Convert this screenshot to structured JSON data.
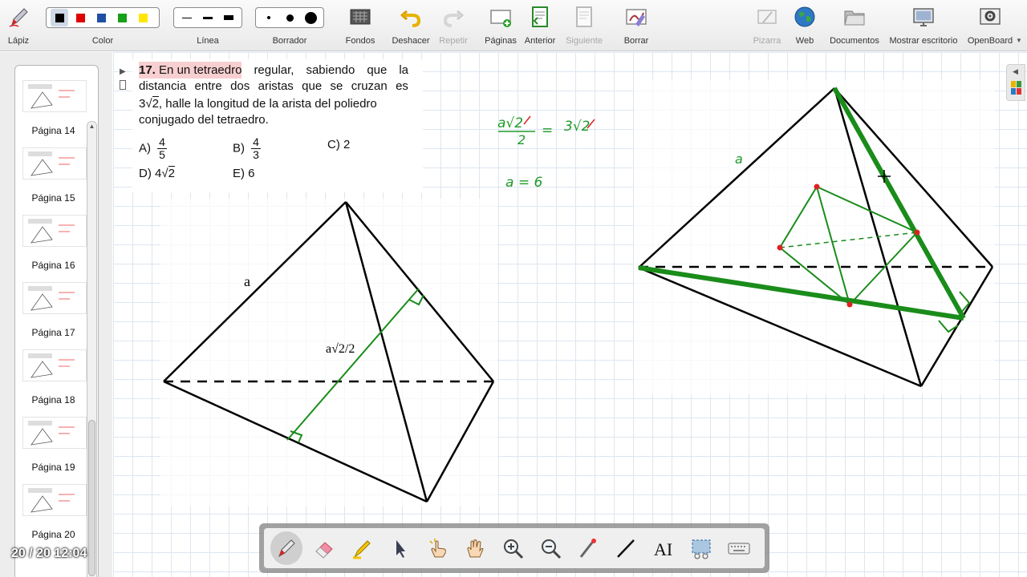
{
  "toolbar": {
    "pen": {
      "label": "Lápiz",
      "icon": "pen-icon"
    },
    "color": {
      "label": "Color",
      "swatches": [
        "#000000",
        "#e00000",
        "#1f4fa3",
        "#18a018",
        "#ffe600"
      ]
    },
    "line": {
      "label": "Línea"
    },
    "eraser": {
      "label": "Borrador"
    },
    "backgrounds": {
      "label": "Fondos",
      "icon": "backgrounds-icon"
    },
    "undo": {
      "label": "Deshacer",
      "icon": "undo-icon"
    },
    "redo": {
      "label": "Repetir",
      "icon": "redo-icon"
    },
    "pages": {
      "label": "Páginas",
      "icon": "add-page-icon"
    },
    "previous": {
      "label": "Anterior",
      "icon": "previous-page-icon"
    },
    "next": {
      "label": "Siguiente",
      "icon": "next-page-icon"
    },
    "clear": {
      "label": "Borrar",
      "icon": "clear-page-icon"
    },
    "board": {
      "label": "Pizarra",
      "icon": "board-icon"
    },
    "web": {
      "label": "Web",
      "icon": "globe-icon"
    },
    "documents": {
      "label": "Documentos",
      "icon": "folder-icon"
    },
    "desktop": {
      "label": "Mostrar escritorio",
      "icon": "monitor-icon"
    },
    "openboard": {
      "label": "OpenBoard",
      "icon": "openboard-gear-icon"
    }
  },
  "sidebar": {
    "thumbnails": [
      {
        "label": "Página 14"
      },
      {
        "label": "Página 15"
      },
      {
        "label": "Página 16"
      },
      {
        "label": "Página 17"
      },
      {
        "label": "Página 18"
      },
      {
        "label": "Página 19"
      },
      {
        "label": "Página 20"
      }
    ],
    "page_counter": "20 / 20 12:04"
  },
  "problem": {
    "number": "17.",
    "line1_words": [
      "En",
      "un",
      "tetraedro",
      "regular,",
      "sabiendo",
      "que",
      "la"
    ],
    "line2_words": [
      "distancia",
      "entre",
      "dos",
      "aristas",
      "que",
      "se",
      "cruzan",
      "es"
    ],
    "line3_prefix": "3",
    "line3_radicand": "2",
    "line3_rest": ", halle la longitud de la arista del poliedro",
    "line4": "conjugado del tetraedro.",
    "options": {
      "a_label": "A)",
      "a_num": "4",
      "a_den": "5",
      "b_label": "B)",
      "b_num": "4",
      "b_den": "3",
      "c": "C) 2",
      "d_label": "D) 4",
      "d_radicand": "2",
      "e": "E) 6"
    }
  },
  "figure_left": {
    "edge_label": "a",
    "distance_label": "a√2/2"
  },
  "handwriting": {
    "eq_left_num": "a√2",
    "eq_left_den": "2",
    "eq_equals": "=",
    "eq_right": "3√2",
    "result": "a = 6",
    "edge_label": "a",
    "ink_color": "#1f9a2a"
  },
  "dock": {
    "tools": [
      "pen-tool-icon",
      "eraser-tool-icon",
      "marker-tool-icon",
      "selector-arrow-icon",
      "interact-hand-icon",
      "pan-hand-icon",
      "zoom-in-icon",
      "zoom-out-icon",
      "laser-pointer-icon",
      "line-tool-icon",
      "text-tool-icon",
      "capture-icon",
      "keyboard-icon"
    ]
  },
  "colors": {
    "ink_green": "#1a8c1a",
    "highlight": "#f8cfd0",
    "grid": "#dde6f0"
  }
}
